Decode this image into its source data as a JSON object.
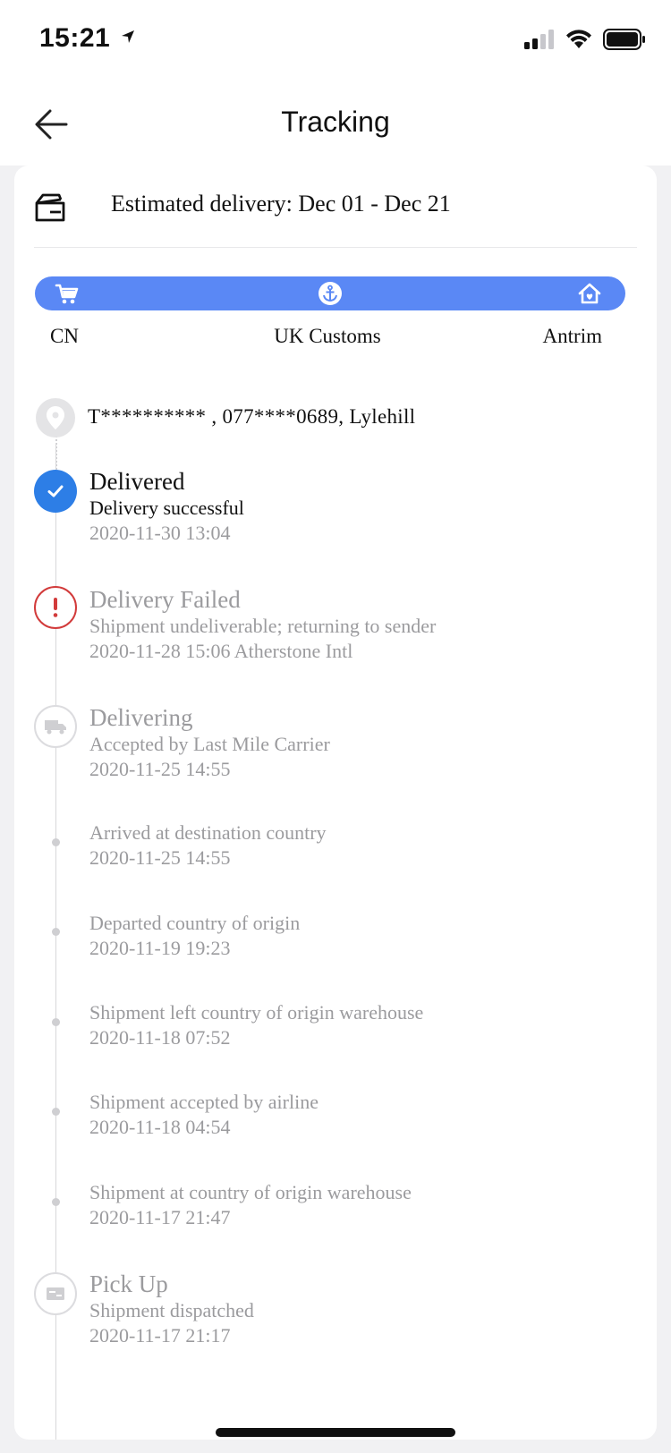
{
  "status_bar": {
    "time": "15:21"
  },
  "header": {
    "title": "Tracking"
  },
  "estimate": {
    "text": "Estimated delivery: Dec 01 - Dec 21"
  },
  "route": {
    "origin": "CN",
    "customs": "UK Customs",
    "destination": "Antrim",
    "accent_color": "#5a88f5"
  },
  "address": {
    "text": "T********** ,  077****0689,  Lylehill"
  },
  "events": [
    {
      "status": "Delivered",
      "detail": "Delivery successful",
      "time": "2020-11-30 13:04",
      "icon": "check-icon"
    },
    {
      "status": "Delivery Failed",
      "detail": "Shipment undeliverable; returning to sender",
      "time": "2020-11-28 15:06 Atherstone Intl",
      "icon": "alert-icon"
    },
    {
      "status": "Delivering",
      "detail": "Accepted by Last Mile Carrier",
      "time": "2020-11-25 14:55",
      "icon": "truck-icon"
    },
    {
      "detail": "Arrived at destination country",
      "time": "2020-11-25 14:55"
    },
    {
      "detail": "Departed country of origin",
      "time": "2020-11-19 19:23"
    },
    {
      "detail": "Shipment left country of origin warehouse",
      "time": "2020-11-18 07:52"
    },
    {
      "detail": "Shipment accepted by airline",
      "time": "2020-11-18 04:54"
    },
    {
      "detail": "Shipment at country of origin warehouse",
      "time": "2020-11-17 21:47"
    },
    {
      "status": "Pick Up",
      "detail": "Shipment dispatched",
      "time": "2020-11-17 21:17",
      "icon": "pickup-icon"
    }
  ],
  "colors": {
    "delivered": "#2d7ee6",
    "failed": "#d23b3b",
    "muted": "#9b9b9e"
  }
}
